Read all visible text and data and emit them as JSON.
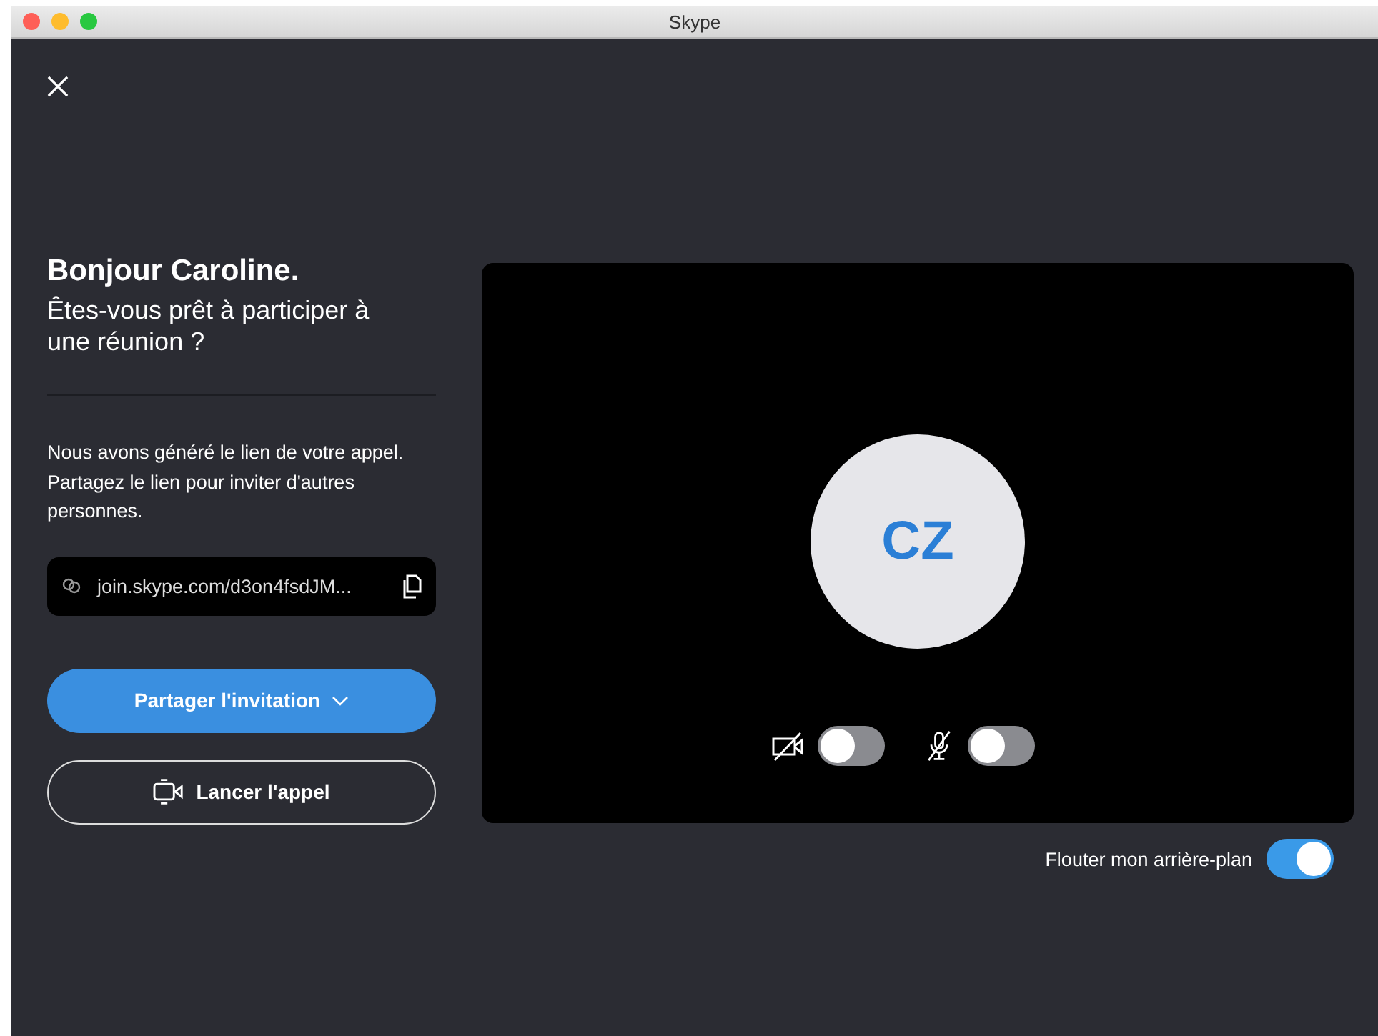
{
  "window": {
    "title": "Skype"
  },
  "greeting": {
    "title": "Bonjour Caroline.",
    "subtitle": "Êtes-vous prêt à participer à une réunion ?"
  },
  "info": "Nous avons généré le lien de votre appel. Partagez le lien pour inviter d'autres personnes.",
  "link": {
    "value": "join.skype.com/d3on4fsdJM..."
  },
  "buttons": [
    {
      "kind": "primary",
      "label": "Partager l'invitation"
    },
    {
      "kind": "outline",
      "label": "Lancer l'appel"
    }
  ],
  "preview": {
    "initials": "CZ"
  },
  "toggles": [
    {
      "kind": "camera",
      "on": false
    },
    {
      "kind": "microphone",
      "on": false
    }
  ],
  "blur": {
    "label": "Flouter mon arrière-plan",
    "on": true
  }
}
